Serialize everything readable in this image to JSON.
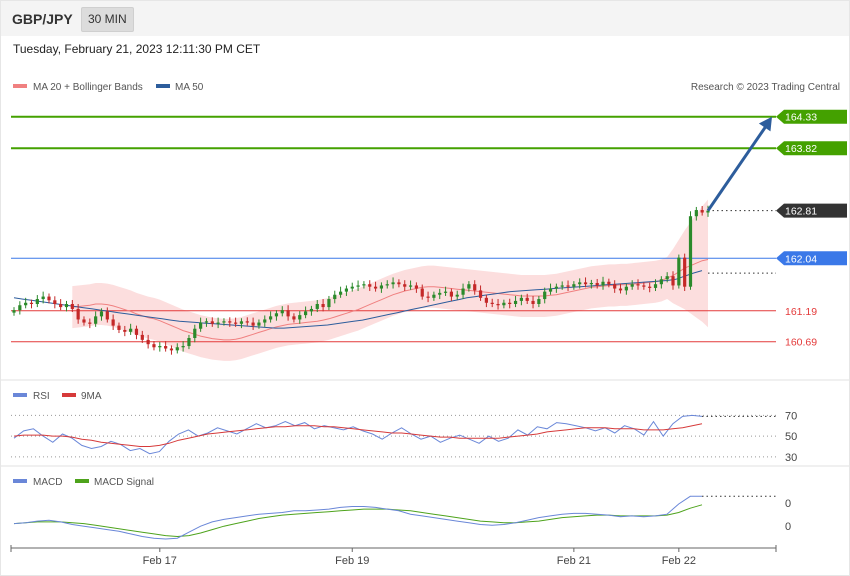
{
  "header": {
    "pair": "GBP/JPY",
    "interval": "30 MIN"
  },
  "timestamp": "Tuesday, February 21, 2023 12:11:30 PM CET",
  "copyright": "Research © 2023 Trading Central",
  "colors": {
    "ma20": "#f08080",
    "ma50": "#2d5d9c",
    "band_fill": "#fcd8d8",
    "up_candle": "#2b8a2b",
    "down_candle": "#c42828",
    "target_green": "#44a100",
    "pivot_blue": "#3a78e8",
    "support_red": "#e43a3a",
    "current_tag": "#333333",
    "arrow": "#2d5d9c",
    "rsi": "#6a87d8",
    "rsi_ma": "#d63a3a",
    "macd": "#6a87d8",
    "macd_signal": "#4ea31c"
  },
  "chart_data": [
    {
      "type": "candlestick",
      "panel": "price",
      "legend": [
        {
          "name": "MA 20 + Bollinger Bands",
          "color": "#f08080"
        },
        {
          "name": "MA 50",
          "color": "#2d5d9c"
        }
      ],
      "ylim": [
        160.2,
        164.6
      ],
      "x_ticks": [
        {
          "label": "Feb 17",
          "index": 25
        },
        {
          "label": "Feb 19",
          "index": 58
        },
        {
          "label": "Feb 21",
          "index": 96
        },
        {
          "label": "Feb 22",
          "index": 114
        }
      ],
      "levels": [
        {
          "value": 164.33,
          "label": "164.33",
          "kind": "resistance",
          "color": "#44a100"
        },
        {
          "value": 163.82,
          "label": "163.82",
          "kind": "resistance",
          "color": "#44a100"
        },
        {
          "value": 162.81,
          "label": "162.81",
          "kind": "current",
          "color": "#333333"
        },
        {
          "value": 162.04,
          "label": "162.04",
          "kind": "pivot",
          "color": "#3a78e8"
        },
        {
          "value": 161.19,
          "label": "161.19",
          "kind": "support",
          "color": "#e43a3a"
        },
        {
          "value": 160.69,
          "label": "160.69",
          "kind": "support",
          "color": "#e43a3a"
        }
      ],
      "target_arrow": {
        "from_value": 162.81,
        "to_value": 164.33
      },
      "close": [
        161.2,
        161.28,
        161.32,
        161.3,
        161.38,
        161.42,
        161.36,
        161.3,
        161.25,
        161.3,
        161.22,
        161.05,
        161.0,
        160.98,
        161.1,
        161.18,
        161.05,
        160.95,
        160.88,
        160.85,
        160.9,
        160.8,
        160.72,
        160.65,
        160.6,
        160.62,
        160.58,
        160.55,
        160.6,
        160.62,
        160.75,
        160.9,
        161.0,
        161.02,
        160.98,
        161.0,
        161.02,
        161.0,
        160.98,
        161.02,
        161.0,
        160.95,
        161.0,
        161.05,
        161.1,
        161.15,
        161.2,
        161.1,
        161.05,
        161.12,
        161.18,
        161.22,
        161.3,
        161.25,
        161.38,
        161.45,
        161.5,
        161.55,
        161.58,
        161.6,
        161.62,
        161.58,
        161.55,
        161.6,
        161.62,
        161.65,
        161.62,
        161.58,
        161.6,
        161.55,
        161.42,
        161.4,
        161.45,
        161.48,
        161.5,
        161.42,
        161.45,
        161.55,
        161.62,
        161.52,
        161.4,
        161.32,
        161.3,
        161.28,
        161.32,
        161.3,
        161.35,
        161.4,
        161.35,
        161.3,
        161.38,
        161.5,
        161.55,
        161.58,
        161.6,
        161.58,
        161.62,
        161.65,
        161.62,
        161.64,
        161.6,
        161.66,
        161.62,
        161.55,
        161.52,
        161.58,
        161.62,
        161.6,
        161.58,
        161.56,
        161.62,
        161.7,
        161.75,
        161.6,
        162.05,
        161.58,
        162.72,
        162.82,
        162.78,
        162.81
      ],
      "ma20": [
        161.25,
        161.26,
        161.27,
        161.28,
        161.3,
        161.3,
        161.29,
        161.27,
        161.24,
        161.21,
        161.18,
        161.14,
        161.11,
        161.08,
        161.06,
        161.03,
        160.99,
        160.95,
        160.91,
        160.87,
        160.84,
        160.81,
        160.78,
        160.76,
        160.74,
        160.73,
        160.72,
        160.72,
        160.73,
        160.75,
        160.78,
        160.81,
        160.84,
        160.87,
        160.9,
        160.93,
        160.95,
        160.97,
        160.98,
        160.99,
        161.0,
        161.01,
        161.02,
        161.04,
        161.06,
        161.09,
        161.12,
        161.15,
        161.18,
        161.21,
        161.25,
        161.29,
        161.33,
        161.37,
        161.41,
        161.45,
        161.48,
        161.51,
        161.53,
        161.55,
        161.57,
        161.58,
        161.58,
        161.57,
        161.56,
        161.55,
        161.54,
        161.53,
        161.52,
        161.51,
        161.5,
        161.49,
        161.48,
        161.47,
        161.46,
        161.45,
        161.44,
        161.43,
        161.43,
        161.43,
        161.43,
        161.43,
        161.44,
        161.45,
        161.47,
        161.49,
        161.51,
        161.53,
        161.55,
        161.57,
        161.58,
        161.59,
        161.6,
        161.6,
        161.61,
        161.61,
        161.62,
        161.63,
        161.64,
        161.65,
        161.66,
        161.68,
        161.72,
        161.76,
        161.82,
        161.88,
        161.92,
        161.96,
        162.0,
        162.02
      ],
      "ma50": [
        161.4,
        161.38,
        161.36,
        161.34,
        161.32,
        161.3,
        161.28,
        161.26,
        161.24,
        161.22,
        161.2,
        161.18,
        161.16,
        161.14,
        161.12,
        161.1,
        161.08,
        161.06,
        161.04,
        161.02,
        161.01,
        161.0,
        160.99,
        160.98,
        160.97,
        160.96,
        160.95,
        160.94,
        160.93,
        160.92,
        160.91,
        160.91,
        160.92,
        160.93,
        160.94,
        160.95,
        160.96,
        160.98,
        161.0,
        161.02,
        161.04,
        161.07,
        161.1,
        161.13,
        161.16,
        161.19,
        161.22,
        161.25,
        161.28,
        161.31,
        161.34,
        161.37,
        161.4,
        161.42,
        161.44,
        161.46,
        161.48,
        161.5,
        161.51,
        161.52,
        161.53,
        161.54,
        161.55,
        161.56,
        161.57,
        161.58,
        161.59,
        161.6,
        161.61,
        161.62,
        161.63,
        161.64,
        161.65,
        161.66,
        161.67,
        161.68,
        161.7,
        161.75,
        161.8,
        161.84
      ],
      "band_width": 0.34
    },
    {
      "type": "line",
      "panel": "rsi",
      "legend": [
        {
          "name": "RSI",
          "color": "#6a87d8"
        },
        {
          "name": "9MA",
          "color": "#d63a3a"
        }
      ],
      "y_ticks": [
        70,
        50,
        30
      ],
      "ylim": [
        25,
        80
      ],
      "series": [
        {
          "name": "RSI",
          "values": [
            48,
            55,
            57,
            50,
            44,
            52,
            48,
            41,
            38,
            40,
            45,
            42,
            36,
            38,
            33,
            35,
            45,
            52,
            56,
            50,
            53,
            58,
            55,
            52,
            57,
            62,
            58,
            60,
            64,
            60,
            63,
            57,
            60,
            58,
            56,
            59,
            55,
            52,
            47,
            53,
            58,
            52,
            47,
            50,
            44,
            48,
            51,
            47,
            43,
            50,
            45,
            48,
            56,
            51,
            59,
            57,
            63,
            62,
            60,
            58,
            55,
            58,
            53,
            60,
            57,
            51,
            64,
            50,
            62,
            69,
            70,
            69
          ]
        },
        {
          "name": "9MA",
          "values": [
            50,
            51,
            51,
            51,
            50,
            50,
            49,
            47,
            46,
            44,
            43,
            42,
            41,
            40,
            40,
            41,
            43,
            46,
            48,
            50,
            52,
            53,
            54,
            55,
            56,
            57,
            58,
            59,
            59,
            60,
            60,
            60,
            59,
            59,
            58,
            57,
            56,
            55,
            54,
            53,
            53,
            52,
            51,
            50,
            49,
            49,
            48,
            48,
            48,
            48,
            48,
            49,
            50,
            51,
            52,
            54,
            55,
            56,
            57,
            58,
            58,
            58,
            57,
            57,
            57,
            56,
            56,
            56,
            57,
            58,
            60,
            62
          ]
        }
      ]
    },
    {
      "type": "line",
      "panel": "macd",
      "legend": [
        {
          "name": "MACD",
          "color": "#6a87d8"
        },
        {
          "name": "MACD Signal",
          "color": "#4ea31c"
        }
      ],
      "y_ticks": [
        0,
        0
      ],
      "ylim": [
        -0.3,
        0.32
      ],
      "series": [
        {
          "name": "MACD",
          "values": [
            -0.05,
            -0.04,
            -0.02,
            -0.01,
            -0.03,
            -0.06,
            -0.08,
            -0.1,
            -0.12,
            -0.14,
            -0.17,
            -0.2,
            -0.22,
            -0.23,
            -0.22,
            -0.15,
            -0.08,
            -0.03,
            0.0,
            0.02,
            0.04,
            0.06,
            0.07,
            0.08,
            0.1,
            0.1,
            0.11,
            0.12,
            0.14,
            0.15,
            0.15,
            0.14,
            0.12,
            0.1,
            0.06,
            0.04,
            0.02,
            0.0,
            -0.02,
            -0.04,
            -0.06,
            -0.07,
            -0.06,
            -0.04,
            -0.01,
            0.02,
            0.04,
            0.06,
            0.07,
            0.07,
            0.06,
            0.05,
            0.03,
            0.04,
            0.03,
            0.04,
            0.06,
            0.18,
            0.27,
            0.27
          ]
        },
        {
          "name": "MACD Signal",
          "values": [
            -0.05,
            -0.04,
            -0.03,
            -0.03,
            -0.03,
            -0.04,
            -0.05,
            -0.07,
            -0.09,
            -0.11,
            -0.13,
            -0.15,
            -0.17,
            -0.19,
            -0.2,
            -0.19,
            -0.16,
            -0.12,
            -0.08,
            -0.05,
            -0.02,
            0.01,
            0.03,
            0.05,
            0.06,
            0.07,
            0.08,
            0.09,
            0.1,
            0.11,
            0.12,
            0.12,
            0.12,
            0.11,
            0.1,
            0.08,
            0.06,
            0.04,
            0.02,
            0.0,
            -0.02,
            -0.03,
            -0.04,
            -0.04,
            -0.03,
            -0.02,
            0.0,
            0.02,
            0.03,
            0.04,
            0.05,
            0.05,
            0.04,
            0.04,
            0.04,
            0.04,
            0.05,
            0.08,
            0.13,
            0.17
          ]
        }
      ]
    }
  ]
}
